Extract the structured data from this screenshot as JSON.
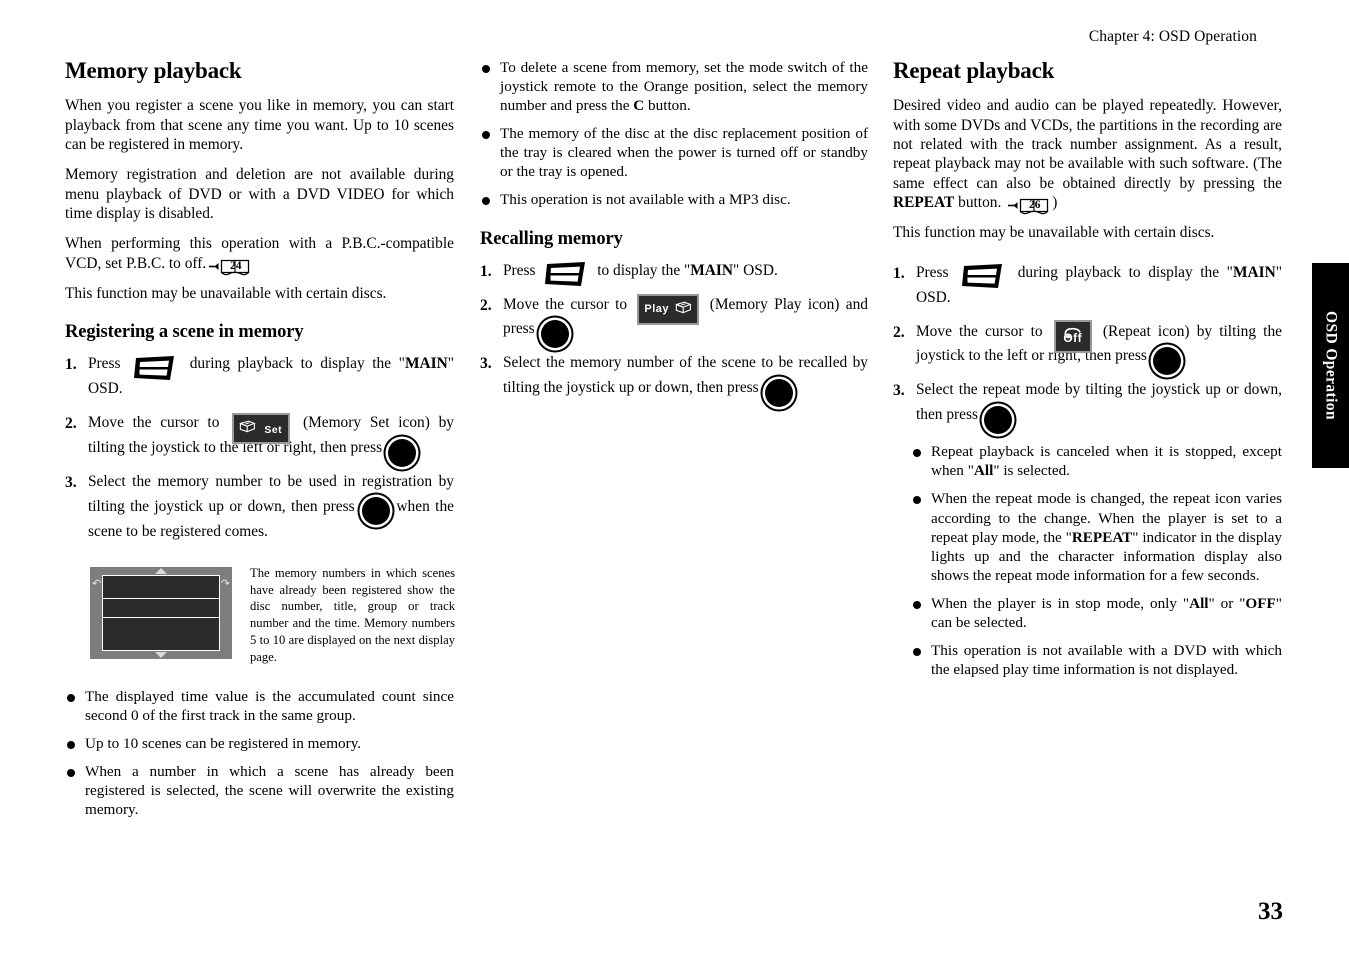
{
  "running_head": "Chapter 4: OSD Operation",
  "side_tab": "OSD Operation",
  "page_number": "33",
  "icons": {
    "display_button": "display-osd-button-icon",
    "enter_button": "joystick-enter-button-icon",
    "memory_set_label": "Set",
    "memory_play_label": "Play",
    "repeat_off_label": "Off",
    "page_ref_24": "24",
    "page_ref_26": "26"
  },
  "column1": {
    "heading": "Memory playback",
    "paragraphs": [
      "When you register a scene you like in memory, you can start playback from that scene any time you want. Up to 10 scenes can be registered in memory.",
      "Memory registration and deletion are not available during menu playback of DVD or with a DVD VIDEO for which time display is disabled."
    ],
    "pbc_text_before": "When performing this operation with a P.B.C.-compatible VCD, set P.B.C. to off.",
    "closing_paragraph": "This function may be unavailable with certain discs.",
    "subheading": "Registering a scene in memory",
    "step1": {
      "num": "1.",
      "before": "Press",
      "after_a": "during playback to display the \"",
      "bold": "MAIN",
      "after_b": "\" OSD."
    },
    "step2": {
      "num": "2.",
      "before": "Move the cursor to",
      "middle": "(Memory Set icon) by tilting the joystick to the left or right, then press",
      "after": "."
    },
    "step3": {
      "num": "3.",
      "before": "Select the memory number to be used in registration by tilting the joystick up or down, then press",
      "after": "when the scene to be registered comes."
    },
    "figure_caption": "The memory numbers in which scenes have already been registered show the disc number, title, group or track number and the time. Memory numbers 5 to 10 are displayed on the next display page.",
    "bullets": [
      "The displayed time value is the accumulated count since second 0 of the first track in the same group.",
      "Up to 10 scenes can be registered in memory.",
      "When a number in which a scene has already been registered is selected, the scene will overwrite the existing memory."
    ]
  },
  "column2": {
    "bullet1_a": "To delete a scene from memory, set the mode switch of the joystick remote to the Orange position, select the memory number and press the ",
    "bullet1_bold": "C",
    "bullet1_b": " button.",
    "bullets": [
      "The memory of the disc at the disc replacement position of the tray is cleared when the power is turned off or standby or the tray is opened.",
      "This operation is not available with a MP3 disc."
    ],
    "subheading": "Recalling memory",
    "step1": {
      "num": "1.",
      "before": "Press",
      "after_a": "to display the \"",
      "bold": "MAIN",
      "after_b": "\" OSD."
    },
    "step2": {
      "num": "2.",
      "before": "Move the cursor to",
      "middle": "(Memory Play icon) and press",
      "after": "."
    },
    "step3": {
      "num": "3.",
      "before": "Select the memory number of the scene to be recalled by tilting the joystick up or down, then press",
      "after": "."
    }
  },
  "column3": {
    "heading": "Repeat playback",
    "paragraph_a": "Desired video and audio can be played repeatedly. However, with some DVDs and VCDs, the partitions in the recording are not related with the track number assignment. As a result, repeat playback may not be available with such software. (The same effect can also be obtained directly by pressing the ",
    "paragraph_bold": "REPEAT",
    "paragraph_b": " button.",
    "paragraph_c": ")",
    "closing_paragraph": "This function may be unavailable with certain discs.",
    "step1": {
      "num": "1.",
      "before": "Press",
      "after_a": "during playback to display the \"",
      "bold": "MAIN",
      "after_b": "\" OSD."
    },
    "step2": {
      "num": "2.",
      "before": "Move the cursor to",
      "middle": "(Repeat icon) by tilting the joystick to the left or right, then press",
      "after": "."
    },
    "step3": {
      "num": "3.",
      "before": "Select the repeat mode by tilting the joystick up or down, then press",
      "after": "."
    },
    "bullets": [
      {
        "a": "Repeat playback is canceled when it is stopped, except when  \"",
        "bold": "All",
        "b": "\" is selected."
      },
      {
        "a": "When the repeat mode is changed, the repeat icon varies according to the change. When the player is set to a repeat play mode, the \"",
        "bold": "REPEAT",
        "b": "\" indicator in the display lights up and the character information display also shows the repeat mode information for a few seconds."
      },
      {
        "a": "When the player is in stop mode, only \"",
        "bold": "All",
        "b": "\" or \"",
        "bold2": "OFF",
        "c": "\" can be selected."
      },
      {
        "a": "This operation is not available with a DVD with which the elapsed play time information is not displayed."
      }
    ]
  }
}
